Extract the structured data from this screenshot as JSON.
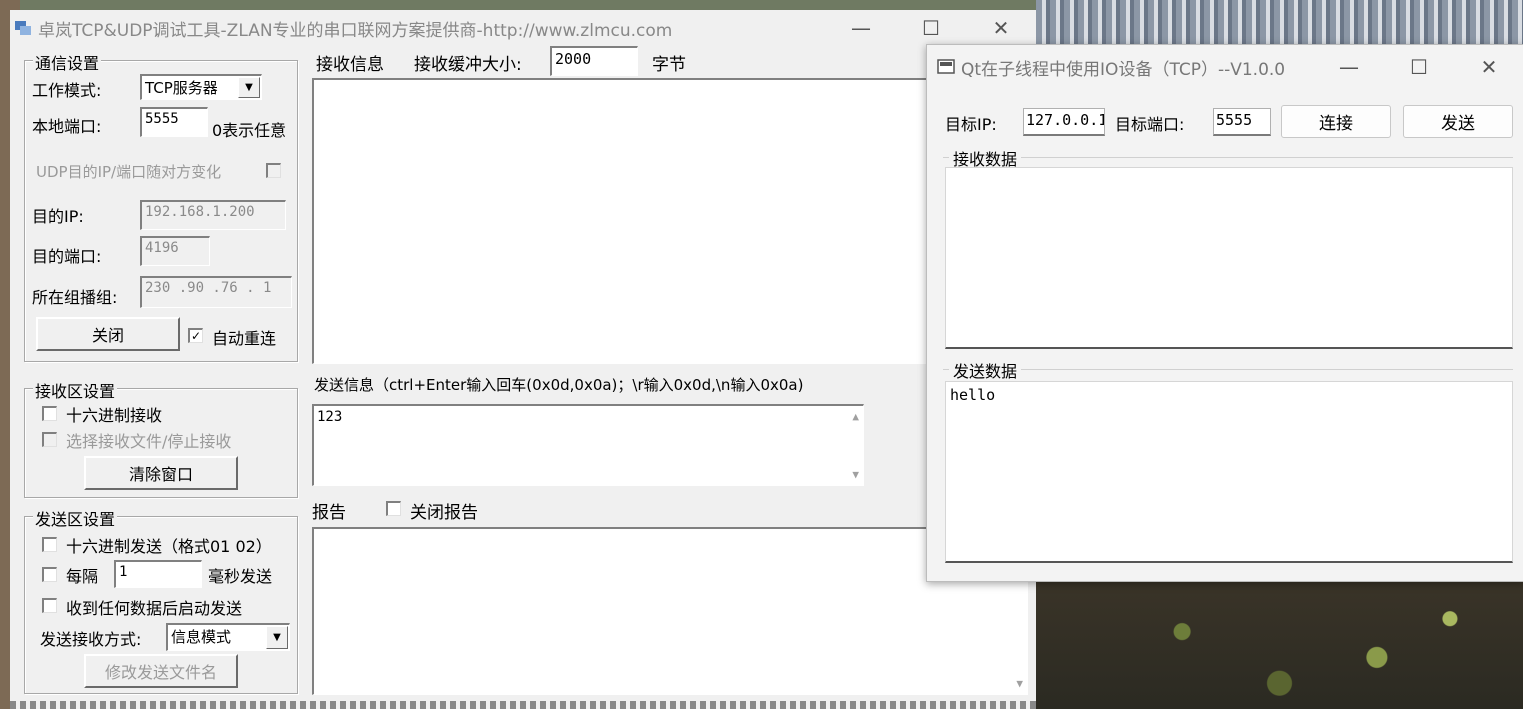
{
  "tool_window": {
    "title": "卓岚TCP&UDP调试工具-ZLAN专业的串口联网方案提供商-http://www.zlmcu.com",
    "comm": {
      "group_title": "通信设置",
      "mode_label": "工作模式:",
      "mode_value": "TCP服务器",
      "local_port_label": "本地端口:",
      "local_port_value": "5555",
      "port_hint": "0表示任意",
      "udp_follow_label": "UDP目的IP/端口随对方变化",
      "dest_ip_label": "目的IP:",
      "dest_ip_value": "192.168.1.200",
      "dest_port_label": "目的端口:",
      "dest_port_value": "4196",
      "multicast_label": "所在组播组:",
      "multicast_value": "230 .90 .76 . 1",
      "close_button": "关闭",
      "auto_reconnect_label": "自动重连",
      "auto_reconnect_checked": "✓"
    },
    "recv_settings": {
      "group_title": "接收区设置",
      "hex_recv_label": "十六进制接收",
      "save_file_label": "选择接收文件/停止接收",
      "clear_button": "清除窗口"
    },
    "send_settings": {
      "group_title": "发送区设置",
      "hex_send_label": "十六进制发送（格式01 02）",
      "every_label": "每隔",
      "every_value": "1",
      "ms_send_label": "毫秒发送",
      "send_on_recv_label": "收到任何数据后启动发送",
      "mode_label": "发送接收方式:",
      "mode_value": "信息模式",
      "rename_button": "修改发送文件名"
    },
    "recv_info": {
      "label": "接收信息",
      "buffer_label": "接收缓冲大小:",
      "buffer_value": "2000",
      "unit": "字节"
    },
    "send_info": {
      "label": "发送信息（ctrl+Enter输入回车(0x0d,0x0a)；\\r输入0x0d,\\n输入0x0a)",
      "content": "123"
    },
    "report": {
      "label": "报告",
      "close_report_label": "关闭报告"
    }
  },
  "qt_window": {
    "title": "Qt在子线程中使用IO设备（TCP）--V1.0.0",
    "target_ip_label": "目标IP:",
    "target_ip_value": "127.0.0.1",
    "target_port_label": "目标端口:",
    "target_port_value": "5555",
    "connect_button": "连接",
    "send_button": "发送",
    "recv_group": "接收数据",
    "recv_content": "",
    "send_group": "发送数据",
    "send_content": "hello"
  },
  "window_controls": {
    "minimize": "—",
    "maximize": "☐",
    "close": "✕"
  }
}
